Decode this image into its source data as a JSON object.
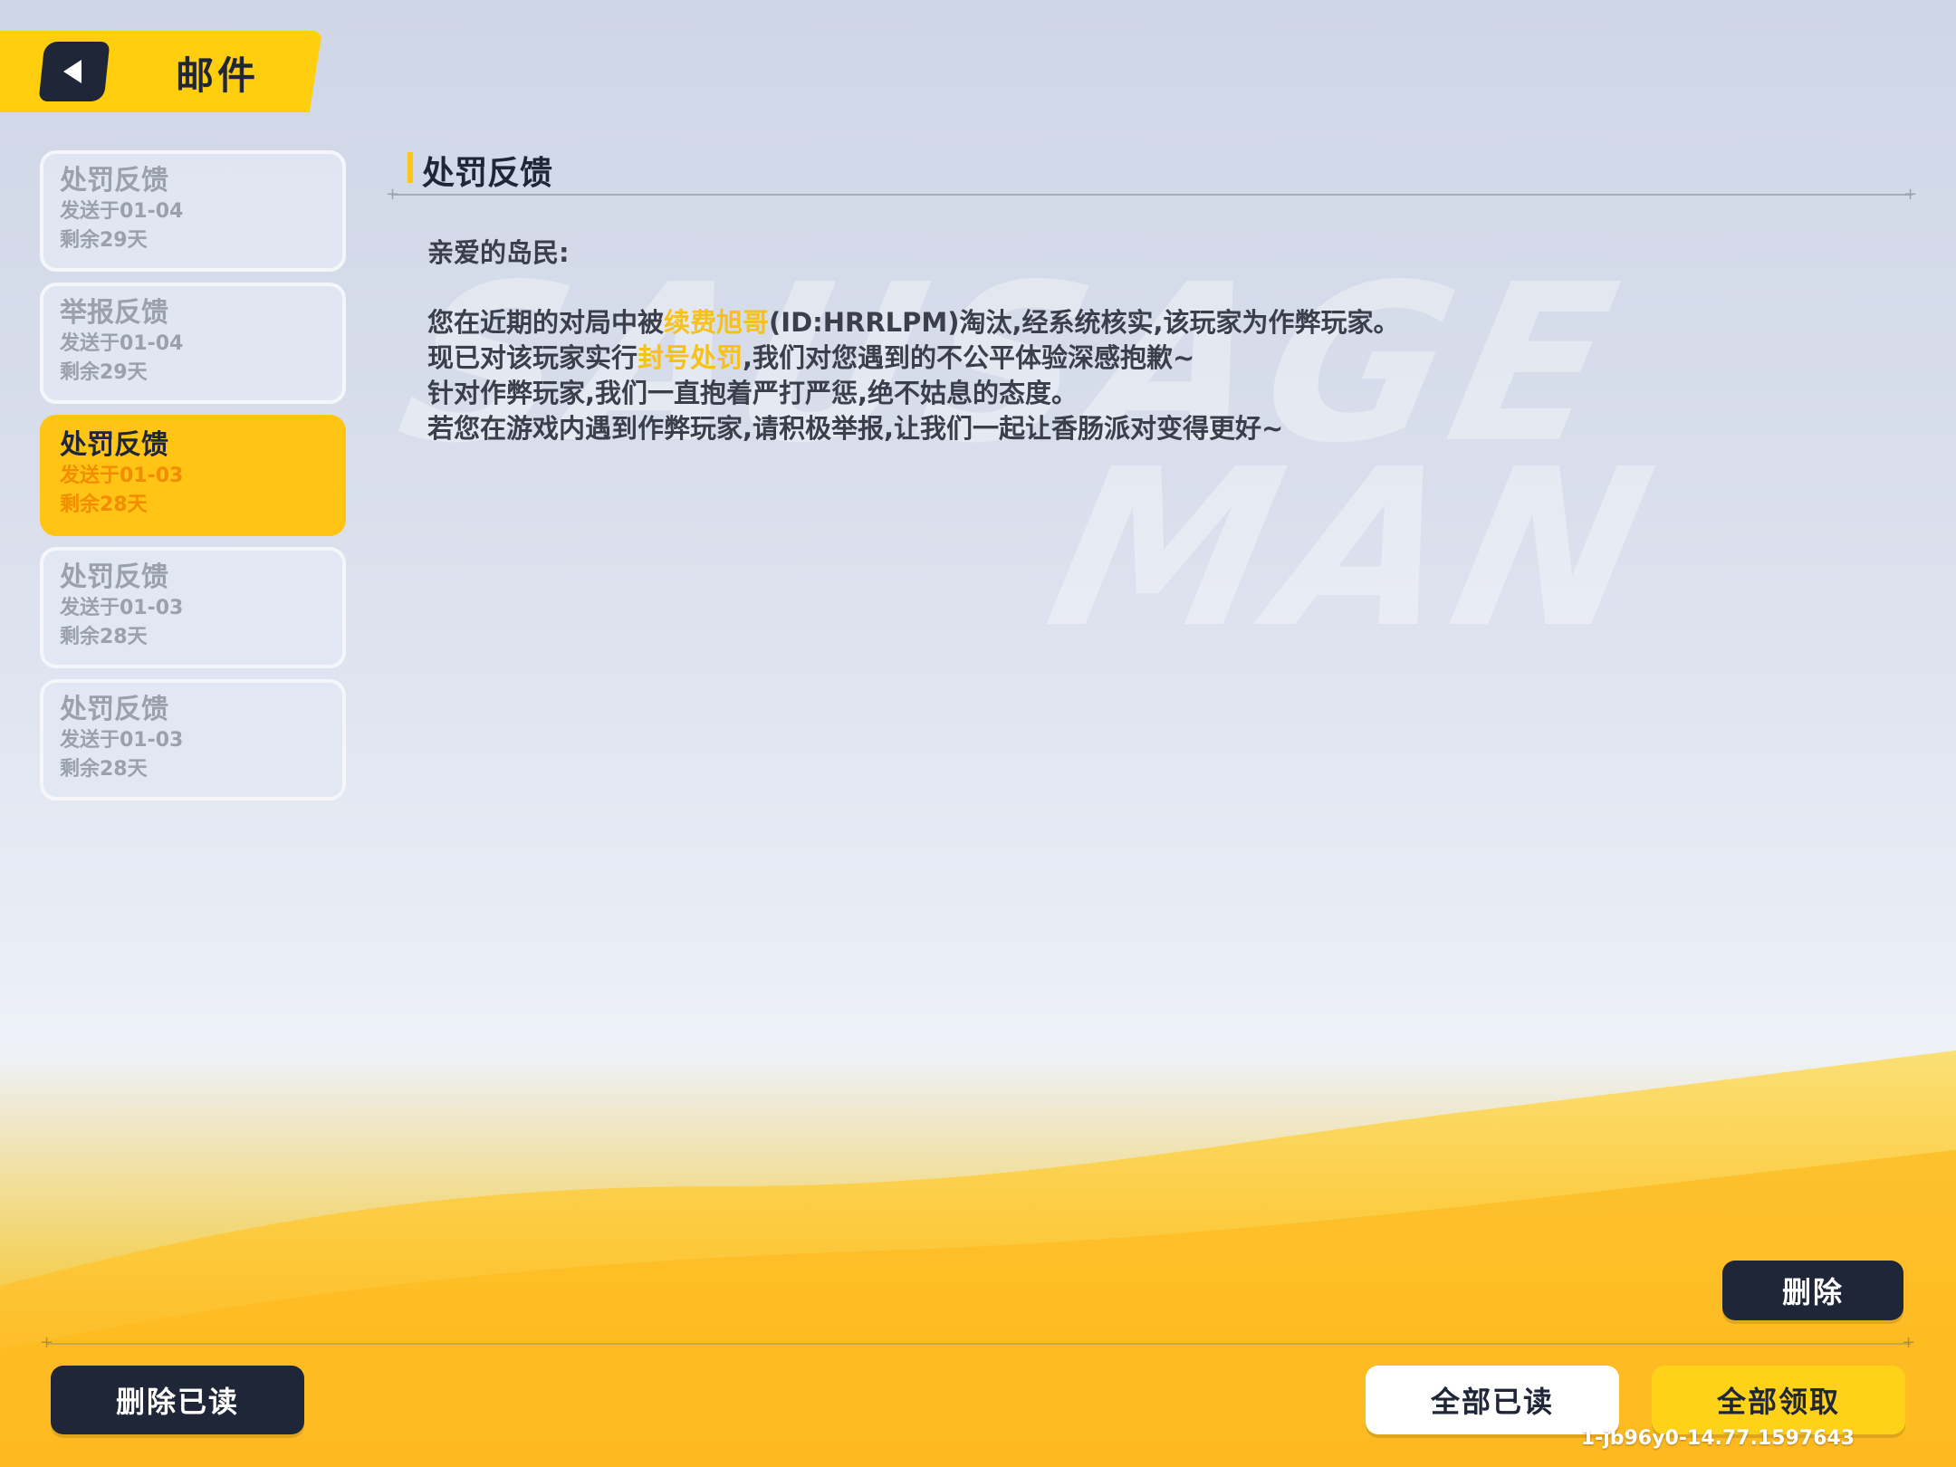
{
  "header": {
    "title": "邮件"
  },
  "mails": [
    {
      "title": "处罚反馈",
      "sent": "发送于01-04",
      "remain": "剩余29天",
      "active": false
    },
    {
      "title": "举报反馈",
      "sent": "发送于01-04",
      "remain": "剩余29天",
      "active": false
    },
    {
      "title": "处罚反馈",
      "sent": "发送于01-03",
      "remain": "剩余28天",
      "active": true
    },
    {
      "title": "处罚反馈",
      "sent": "发送于01-03",
      "remain": "剩余28天",
      "active": false
    },
    {
      "title": "处罚反馈",
      "sent": "发送于01-03",
      "remain": "剩余28天",
      "active": false
    }
  ],
  "detail": {
    "title": "处罚反馈",
    "greeting": "亲爱的岛民:",
    "line1_a": "您在近期的对局中被",
    "line1_name": "续费旭哥",
    "line1_b": "(ID:HRRLPM)淘汰,经系统核实,该玩家为作弊玩家。",
    "line2_a": "现已对该玩家实行",
    "line2_penalty": "封号处罚",
    "line2_b": ",我们对您遇到的不公平体验深感抱歉~",
    "line3": "针对作弊玩家,我们一直抱着严打严惩,绝不姑息的态度。",
    "line4": "若您在游戏内遇到作弊玩家,请积极举报,让我们一起让香肠派对变得更好~"
  },
  "buttons": {
    "delete": "删除",
    "delete_read": "删除已读",
    "read_all": "全部已读",
    "claim_all": "全部领取"
  },
  "version": "1-jb96y0-14.77.1597643",
  "colors": {
    "accent_yellow": "#ffc414",
    "dark": "#1f2638",
    "highlight": "#f6c21a"
  },
  "icons": {
    "back": "back-triangle-icon"
  }
}
